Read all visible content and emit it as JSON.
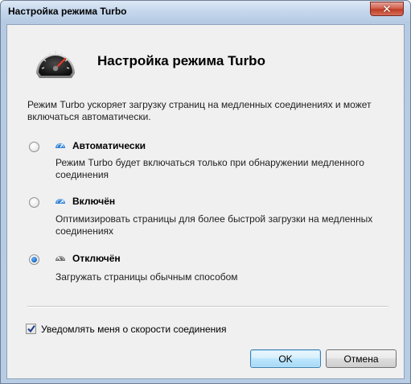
{
  "window": {
    "title": "Настройка режима Turbo",
    "close_icon": "close-icon",
    "close_glyph": "✕"
  },
  "header": {
    "icon": "speedometer-icon",
    "title": "Настройка режима Turbo"
  },
  "description": "Режим Turbo ускоряет загрузку страниц на медленных соединениях и может включаться автоматически.",
  "modes": [
    {
      "label": "Автоматически",
      "description": "Режим Turbo будет включаться только при обнаружении медленного соединения",
      "checked": false,
      "icon": "turbo-auto-icon",
      "icon_color": "#2f7fd3"
    },
    {
      "label": "Включён",
      "description": "Оптимизировать страницы для более быстрой загрузки на медленных соединениях",
      "checked": false,
      "icon": "turbo-on-icon",
      "icon_color": "#2f7fd3"
    },
    {
      "label": "Отключён",
      "description": "Загружать страницы обычным способом",
      "checked": true,
      "icon": "turbo-off-icon",
      "icon_color": "#6d6d6d"
    }
  ],
  "notify": {
    "label": "Уведомлять меня о скорости соединения",
    "checked": true
  },
  "buttons": {
    "ok": "OK",
    "cancel": "Отмена"
  }
}
